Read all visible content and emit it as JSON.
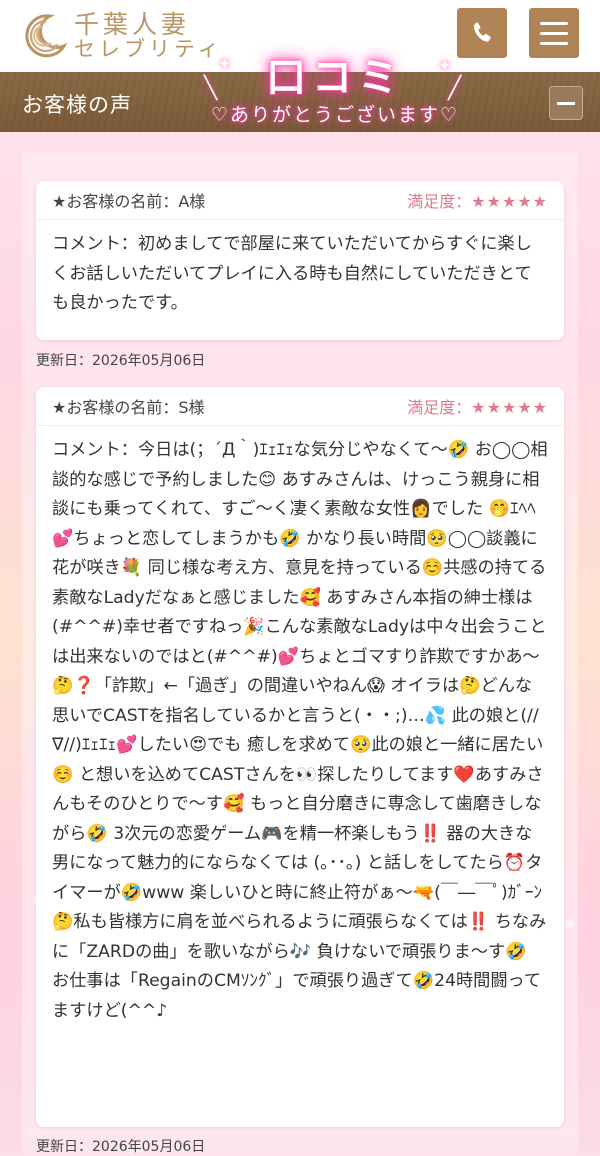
{
  "header": {
    "logo_line1": "千葉人妻",
    "logo_line2": "セレブリティ",
    "phone_icon": "phone-icon",
    "menu_icon": "hamburger-menu-icon"
  },
  "section": {
    "title": "お客様の声",
    "banner_title": "口コミ",
    "banner_subtitle": "ありがとうございます"
  },
  "reviews": [
    {
      "name_label": "★お客様の名前：A様",
      "satisfaction_label": "満足度：",
      "stars": "★★★★★",
      "comment": "コメント：初めましてで部屋に来ていただいてからすぐに楽しくお話しいただいてプレイに入る時も自然にしていただきとても良かったです。",
      "updated": "更新日：2026年05月06日"
    },
    {
      "name_label": "★お客様の名前：S様",
      "satisfaction_label": "満足度：",
      "stars": "★★★★★",
      "comment": "コメント：今日は(；´Д｀)ｴｪｴｪな気分じやなくて〜🤣 お◯◯相談的な感じで予約しました😊 あすみさんは、けっこう親身に相談にも乗ってくれて、すご〜く凄く素敵な女性👩でした 🤭ｴﾍﾍ💕ちょっと恋してしまうかも🤣 かなり長い時間🥺◯◯談義に花が咲き💐 同じ様な考え方、意見を持っている☺️共感の持てる素敵なLadyだなぁと感じました🥰 あすみさん本指の紳士様は(#^^#)幸せ者ですねっ🎉こんな素敵なLadyは中々出会うことは出来ないのではと(#^^#)💕ちょとゴマすり詐欺ですかあ〜🤔❓「詐欺」←「過ぎ」の間違いやねん😱 オイラは🤔どんな思いでCASTを指名しているかと言うと(・・;)…💦 此の娘と(//∇//)ｴｪｴｪ💕したい😍でも 癒しを求めて🥺此の娘と一緒に居たい☺️ と想いを込めてCASTさんを👀探したりしてます❤️あすみさんもそのひとりで〜す🥰 もっと自分磨きに専念して歯磨きしながら🤣 3次元の恋愛ゲーム🎮を精一杯楽しもう‼️ 器の大きな男になって魅力的にならなくては (｡･･｡) と話しをしてたら⏰タイマーが🤣www 楽しいひと時に終止符がぁ〜🔫(￣―￣ﾟ)ｶﾞｰﾝ 🤔私も皆様方に肩を並べられるように頑張らなくては‼️ ちなみに「ZARDの曲」を歌いながら🎶 負けないで頑張りま〜す🤣 お仕事は「RegainのCMｿﾝｸﾞ」で頑張り過ぎて🤣24時間闘ってますけど(^^♪",
      "updated": "更新日：2026年05月06日"
    }
  ]
}
